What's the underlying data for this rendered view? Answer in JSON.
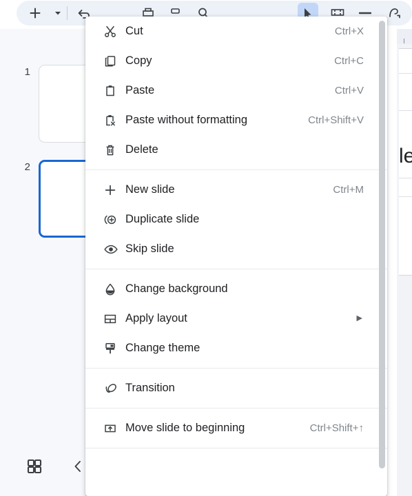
{
  "toolbar": {
    "buttons": [
      {
        "name": "new-slide-button",
        "icon": "plus-icon"
      },
      {
        "name": "new-slide-dropdown-button",
        "icon": "caret-down-icon"
      },
      {
        "name": "undo-button",
        "icon": "undo-arrow-icon"
      },
      {
        "name": "print-button",
        "icon": "print-icon"
      },
      {
        "name": "paint-format-button",
        "icon": "paint-roller-icon"
      },
      {
        "name": "zoom-button",
        "icon": "magnifier-icon"
      },
      {
        "name": "select-tool-button",
        "icon": "cursor-arrow-icon"
      },
      {
        "name": "text-box-button",
        "icon": "text-box-icon"
      },
      {
        "name": "line-button",
        "icon": "line-icon"
      },
      {
        "name": "curve-button",
        "icon": "curve-icon"
      }
    ],
    "selected_tool": "cursor-arrow-icon"
  },
  "filmstrip": {
    "slides": [
      {
        "number": "1",
        "selected": false
      },
      {
        "number": "2",
        "selected": true
      }
    ],
    "footer": {
      "grid_view_label": "grid-view",
      "collapse_label": "collapse-filmstrip"
    }
  },
  "canvas": {
    "slide_text_fragment": "le"
  },
  "context_menu": {
    "groups": [
      {
        "items": [
          {
            "label": "Cut",
            "shortcut": "Ctrl+X",
            "icon": "scissors-icon",
            "name": "menu-item-cut"
          },
          {
            "label": "Copy",
            "shortcut": "Ctrl+C",
            "icon": "copy-icon",
            "name": "menu-item-copy"
          },
          {
            "label": "Paste",
            "shortcut": "Ctrl+V",
            "icon": "clipboard-icon",
            "name": "menu-item-paste"
          },
          {
            "label": "Paste without formatting",
            "shortcut": "Ctrl+Shift+V",
            "icon": "clipboard-no-format-icon",
            "name": "menu-item-paste-without-formatting"
          },
          {
            "label": "Delete",
            "shortcut": "",
            "icon": "trash-icon",
            "name": "menu-item-delete"
          }
        ]
      },
      {
        "items": [
          {
            "label": "New slide",
            "shortcut": "Ctrl+M",
            "icon": "plus-icon",
            "name": "menu-item-new-slide"
          },
          {
            "label": "Duplicate slide",
            "shortcut": "",
            "icon": "duplicate-slide-icon",
            "name": "menu-item-duplicate-slide"
          },
          {
            "label": "Skip slide",
            "shortcut": "",
            "icon": "eye-icon",
            "name": "menu-item-skip-slide"
          }
        ]
      },
      {
        "items": [
          {
            "label": "Change background",
            "shortcut": "",
            "icon": "droplet-icon",
            "name": "menu-item-change-background"
          },
          {
            "label": "Apply layout",
            "shortcut": "",
            "icon": "layout-icon",
            "submenu": true,
            "name": "menu-item-apply-layout"
          },
          {
            "label": "Change theme",
            "shortcut": "",
            "icon": "paint-brush-icon",
            "name": "menu-item-change-theme"
          }
        ]
      },
      {
        "items": [
          {
            "label": "Transition",
            "shortcut": "",
            "icon": "transition-icon",
            "name": "menu-item-transition"
          }
        ]
      },
      {
        "items": [
          {
            "label": "Move slide to beginning",
            "shortcut": "Ctrl+Shift+↑",
            "icon": "move-to-beginning-icon",
            "name": "menu-item-move-slide-to-beginning"
          }
        ]
      }
    ],
    "submenu_arrow": "▶",
    "scrollbar": {
      "name": "menu-scrollbar"
    }
  },
  "colors": {
    "accent": "#1967d2",
    "toolbar_bg": "#edf1f8",
    "filmstrip_bg": "#f6f8fc",
    "menu_bg": "#ffffff",
    "text": "#202124",
    "shortcut_text": "#80868b",
    "tool_selected_bg": "#c2d7f7"
  }
}
